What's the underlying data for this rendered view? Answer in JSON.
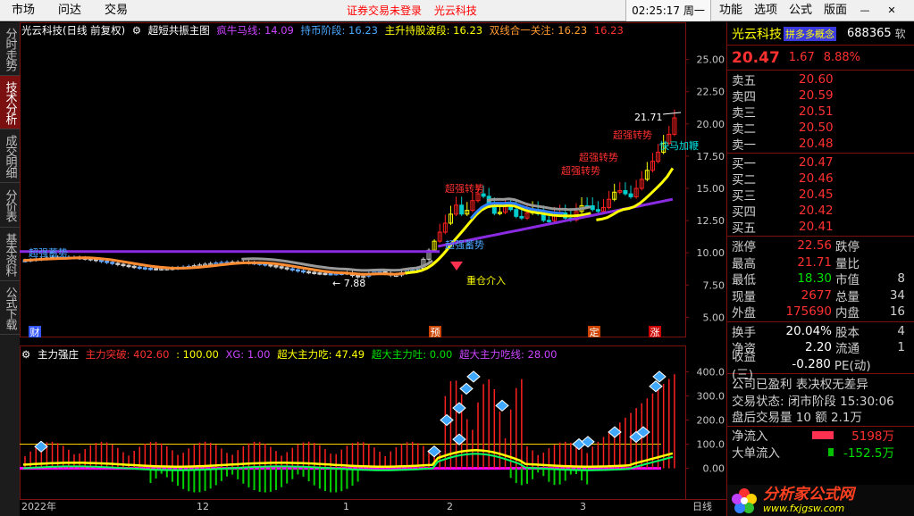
{
  "topbar": {
    "menus": [
      "市场",
      "问达",
      "交易"
    ],
    "status_text": "证券交易未登录",
    "stock_title": "光云科技",
    "clock": "02:25:17 周一",
    "right_menus": [
      "功能",
      "选项",
      "公式",
      "版面"
    ],
    "minimize": "—",
    "close": "✕"
  },
  "side_tabs": [
    "分时走势",
    "技术分析",
    "成交明细",
    "分价表",
    "基本资料",
    "公式下载"
  ],
  "side_active": 1,
  "main_chart": {
    "title": "光云科技(日线 前复权)",
    "formula": "超短共振主图",
    "legend": [
      {
        "text": "疯牛马线: 14.09",
        "color": "#cc44ff"
      },
      {
        "text": "持币阶段: 16.23",
        "color": "#4aa8ff"
      },
      {
        "text": "主升持股波段: 16.23",
        "color": "#ffff00"
      },
      {
        "text": "双线合一关注: 16.23",
        "color": "#ff9a30"
      },
      {
        "text": "16.23",
        "color": "#ff3030"
      }
    ],
    "y_ticks": [
      "25.00",
      "22.50",
      "20.00",
      "17.50",
      "15.00",
      "12.50",
      "10.00",
      "7.50",
      "5.00"
    ],
    "annotations": {
      "high": "21.71",
      "low": "7.88",
      "signal_1": "超强转势",
      "signal_2": "超强转势",
      "signal_3": "超强转势",
      "signal_4": "超强转势",
      "signal_5": "超强转势",
      "accumulate": "重仓介入",
      "fast_horse": "快马加鞭",
      "left_label": "超强蓄势",
      "mid_label": "超强蓄势"
    },
    "markers": [
      "财",
      "预",
      "定",
      "涨"
    ]
  },
  "sub_chart": {
    "title": "主力强庄",
    "legend": [
      {
        "text": "主力突破: 402.60",
        "color": "#ff3030"
      },
      {
        "text": ": 100.00",
        "color": "#ffff00"
      },
      {
        "text": "XG: 1.00",
        "color": "#cc44ff"
      },
      {
        "text": "超大主力吃: 47.49",
        "color": "#ffff00"
      },
      {
        "text": "超大主力吐: 0.00",
        "color": "#00e000"
      },
      {
        "text": "超大主力吃线: 28.00",
        "color": "#cc44ff"
      }
    ],
    "y_ticks": [
      "400.0",
      "300.0",
      "200.0",
      "100.0",
      "0.00"
    ]
  },
  "x_axis": {
    "labels": [
      "2022年",
      "12",
      "1",
      "2",
      "3"
    ],
    "period": "日线"
  },
  "chart_data": {
    "type": "candlestick",
    "title": "光云科技(日线 前复权)",
    "ylim": [
      3.5,
      26.5
    ],
    "x_labels": [
      "2022年",
      "12",
      "1",
      "2",
      "3"
    ],
    "indicator_lines": {
      "疯牛马线": 14.09,
      "持币阶段": 16.23,
      "主升持股波段": 16.23,
      "双线合一关注": 16.23
    },
    "sub_indicator": {
      "name": "主力强庄",
      "ylim": [
        -120,
        450
      ],
      "主力突破": 402.6,
      "threshold": 100.0,
      "XG": 1.0,
      "超大主力吃": 47.49,
      "超大主力吐": 0.0,
      "超大主力吃线": 28.0
    }
  },
  "quote": {
    "name": "光云科技",
    "tag": "拼多多概念",
    "code": "688365",
    "code_suffix": "软",
    "last": "20.47",
    "change": "1.67",
    "pct": "8.88%",
    "asks": [
      {
        "label": "卖五",
        "price": "20.60"
      },
      {
        "label": "卖四",
        "price": "20.59"
      },
      {
        "label": "卖三",
        "price": "20.51"
      },
      {
        "label": "卖二",
        "price": "20.50"
      },
      {
        "label": "卖一",
        "price": "20.48"
      }
    ],
    "bids": [
      {
        "label": "买一",
        "price": "20.47"
      },
      {
        "label": "买二",
        "price": "20.46"
      },
      {
        "label": "买三",
        "price": "20.45"
      },
      {
        "label": "买四",
        "price": "20.42"
      },
      {
        "label": "买五",
        "price": "20.41"
      }
    ],
    "stats1": [
      {
        "k1": "涨停",
        "v1": "22.56",
        "c1": "red",
        "k2": "跌停",
        "v2": ""
      },
      {
        "k1": "最高",
        "v1": "21.71",
        "c1": "red",
        "k2": "量比",
        "v2": ""
      },
      {
        "k1": "最低",
        "v1": "18.30",
        "c1": "grn",
        "k2": "市值",
        "v2": "8"
      },
      {
        "k1": "现量",
        "v1": "2677",
        "c1": "red",
        "k2": "总量",
        "v2": "34"
      },
      {
        "k1": "外盘",
        "v1": "175690",
        "c1": "red",
        "k2": "内盘",
        "v2": "16"
      }
    ],
    "stats2": [
      {
        "k1": "换手",
        "v1": "20.04%",
        "c1": "wht",
        "k2": "股本",
        "v2": "4"
      },
      {
        "k1": "净资",
        "v1": "2.20",
        "c1": "wht",
        "k2": "流通",
        "v2": "1"
      },
      {
        "k1": "收益(三)",
        "v1": "-0.280",
        "c1": "wht",
        "k2": "PE(动)",
        "v2": ""
      }
    ],
    "info": [
      "公司已盈利 表决权无差异",
      "交易状态: 闭市阶段 15:30:06",
      "盘后交易量 10 额 2.1万"
    ],
    "flows": [
      {
        "label": "净流入",
        "value": "5198万",
        "bar": "#ff3050",
        "vcolor": "red"
      },
      {
        "label": "大单流入",
        "value": "-152.5万",
        "bar": "#00c000",
        "vcolor": "grn"
      }
    ],
    "logo_title": "分析家公式网",
    "logo_url": "www.fxjgsw.com"
  }
}
